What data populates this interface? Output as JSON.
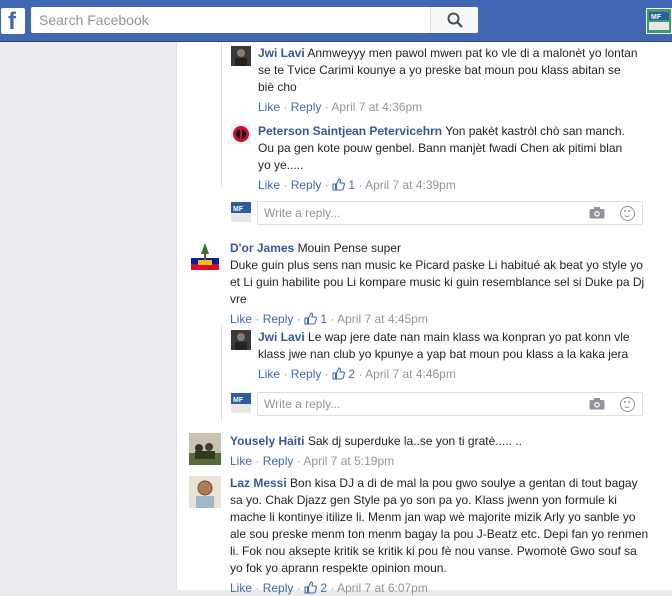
{
  "search": {
    "placeholder": "Search Facebook"
  },
  "reply_box": {
    "placeholder": "Write a reply..."
  },
  "actions": {
    "like": "Like",
    "reply": "Reply",
    "sep": "·"
  },
  "comments": [
    {
      "author": "Jwi Lavi",
      "text": "Anmweyyy men pawol mwen pat ko vle di a malonèt yo lontan se te Tvice Carimi kounye a yo preske bat moun pou klass abitan se biè cho",
      "time": "April 7 at 4:36pm",
      "likes": ""
    },
    {
      "author": "Peterson Saintjean Petervicehrn",
      "text": "Yon pakèt kastròl chò san manch. Ou pa gen kote pouw genbel. Bann manjèt fwadi Chen ak pitimi blan yo ye.....",
      "time": "April 7 at 4:39pm",
      "likes": "1"
    },
    {
      "author": "D'or James",
      "text_line1": "Mouin Pense super",
      "text": "Duke guin plus sens nan music ke Picard paske Li habitué ak beat yo style yo et Li guin habilite pou Li kompare music ki guin resemblance sel si Duke pa Dj vre",
      "time": "April 7 at 4:45pm",
      "likes": "1"
    },
    {
      "author": "Jwi Lavi",
      "text": "Le wap jere date nan main klass wa konpran yo pat konn vle klass jwe nan club yo kpunye a yap bat moun pou klass a la kaka jera",
      "time": "April 7 at 4:46pm",
      "likes": "2"
    },
    {
      "author": "Yousely Haiti",
      "text": "Sak dj superduke la..se yon ti gratè..... ..",
      "time": "April 7 at 5:19pm",
      "likes": ""
    },
    {
      "author": "Laz Messi",
      "text": "Bon kisa DJ a di de mal la pou gwo soulye a gentan di tout bagay sa yo. Chak Djazz gen Style pa yo son pa yo. Klass jwenn yon formule ki mache li kontinye itilize li. Menm jan wap wè majorite mizik Arly yo sanble yo ale sou preske menm ton menm bagay la pou J-Beatz etc. Depi fan yo renmen li. Fok nou aksepte kritik se kritik ki pou fè nou vanse. Pwomotè Gwo souf sa yo fok yo aprann respekte opinion moun.",
      "time": "April 7 at 6:07pm",
      "likes": "2"
    }
  ],
  "colors": {
    "brand": "#4267b2",
    "name": "#365899",
    "meta": "#90949c"
  }
}
